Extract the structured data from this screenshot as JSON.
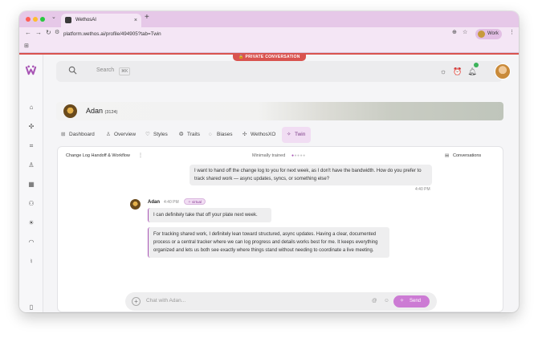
{
  "browser": {
    "tab_title": "WethosAI",
    "tab_close": "×",
    "new_tab": "+",
    "url": "platform.wethos.ai/profile/494905?tab=Twin",
    "profile_label": "Work"
  },
  "colors": {
    "accent": "#a855b5",
    "private_red": "#d9534f",
    "browser_chrome": "#e6c8e8"
  },
  "private_badge": "🔒 PRIVATE CONVERSATION",
  "search": {
    "placeholder": "Search",
    "shortcut": "⌘K"
  },
  "profile": {
    "name": "Adan",
    "id": "(3124)"
  },
  "tabs": [
    {
      "label": "Dashboard",
      "icon": "grid-icon"
    },
    {
      "label": "Overview",
      "icon": "person-icon"
    },
    {
      "label": "Styles",
      "icon": "heart-icon"
    },
    {
      "label": "Traits",
      "icon": "brain-icon"
    },
    {
      "label": "Biases",
      "icon": "chat-icon"
    },
    {
      "label": "WethosXO",
      "icon": "nodes-icon"
    },
    {
      "label": "Twin",
      "icon": "sparkle-icon",
      "active": true
    }
  ],
  "panel": {
    "title": "Change Log Handoff & Workflow",
    "trained_label": "Minimally trained",
    "trained_level": 1,
    "trained_max": 5,
    "conversations_label": "Conversations"
  },
  "messages": {
    "user": {
      "text": "I want to hand off the change log to you for next week, as I don't have the bandwidth. How do you prefer to track shared work — async updates, syncs, or something else?",
      "time": "4:40 PM"
    },
    "ai": {
      "name": "Adan",
      "time": "4:40 PM",
      "badge": "✧ virtual",
      "bubble1": "I can definitely take that off your plate next week.",
      "bubble2": "For tracking shared work, I definitely lean toward structured, async updates. Having a clear, documented process or a central tracker where we can log progress and details works best for me. It keeps everything organized and lets us both see exactly where things stand without needing to coordinate a live meeting."
    }
  },
  "chat": {
    "placeholder": "Chat with Adan...",
    "send_label": "Send"
  }
}
